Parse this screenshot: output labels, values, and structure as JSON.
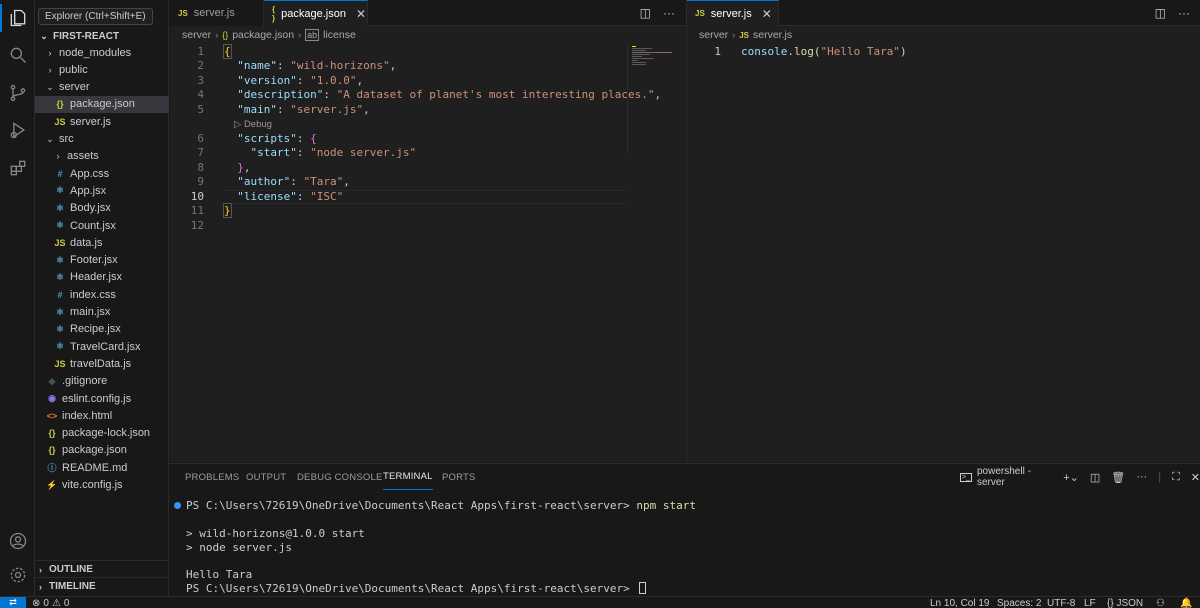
{
  "tooltip": "Explorer (Ctrl+Shift+E)",
  "sidebar": {
    "root": "FIRST-REACT",
    "outline": "OUTLINE",
    "timeline": "TIMELINE",
    "items": [
      {
        "label": "node_modules",
        "icon": "folder",
        "chev": "›"
      },
      {
        "label": "public",
        "icon": "folder",
        "chev": "›"
      },
      {
        "label": "server",
        "icon": "folder-open",
        "chev": "⌄"
      },
      {
        "label": "package.json",
        "icon": "json",
        "glyph": "{}"
      },
      {
        "label": "server.js",
        "icon": "js",
        "glyph": "JS"
      },
      {
        "label": "src",
        "icon": "folder-open",
        "chev": "⌄"
      },
      {
        "label": "assets",
        "icon": "folder",
        "chev": "›"
      },
      {
        "label": "App.css",
        "icon": "css",
        "glyph": "#"
      },
      {
        "label": "App.jsx",
        "icon": "react",
        "glyph": "⚛"
      },
      {
        "label": "Body.jsx",
        "icon": "react",
        "glyph": "⚛"
      },
      {
        "label": "Count.jsx",
        "icon": "react",
        "glyph": "⚛"
      },
      {
        "label": "data.js",
        "icon": "js",
        "glyph": "JS"
      },
      {
        "label": "Footer.jsx",
        "icon": "react",
        "glyph": "⚛"
      },
      {
        "label": "Header.jsx",
        "icon": "react",
        "glyph": "⚛"
      },
      {
        "label": "index.css",
        "icon": "css",
        "glyph": "#"
      },
      {
        "label": "main.jsx",
        "icon": "react",
        "glyph": "⚛"
      },
      {
        "label": "Recipe.jsx",
        "icon": "react",
        "glyph": "⚛"
      },
      {
        "label": "TravelCard.jsx",
        "icon": "react",
        "glyph": "⚛"
      },
      {
        "label": "travelData.js",
        "icon": "js",
        "glyph": "JS"
      },
      {
        "label": ".gitignore",
        "icon": "git",
        "glyph": "◆"
      },
      {
        "label": "eslint.config.js",
        "icon": "eslint",
        "glyph": "◉"
      },
      {
        "label": "index.html",
        "icon": "html",
        "glyph": "<>"
      },
      {
        "label": "package-lock.json",
        "icon": "json",
        "glyph": "{}"
      },
      {
        "label": "package.json",
        "icon": "json",
        "glyph": "{}"
      },
      {
        "label": "README.md",
        "icon": "info",
        "glyph": "ⓘ"
      },
      {
        "label": "vite.config.js",
        "icon": "vite",
        "glyph": "⚡"
      }
    ]
  },
  "editor_left": {
    "tabs": [
      {
        "label": "server.js",
        "glyph": "JS"
      },
      {
        "label": "package.json",
        "glyph": "{ }"
      }
    ],
    "breadcrumb": [
      "server",
      "package.json",
      "license"
    ],
    "codelens": "▷ Debug",
    "lines": [
      "1",
      "2",
      "3",
      "4",
      "5",
      "6",
      "7",
      "8",
      "9",
      "10",
      "11",
      "12"
    ],
    "code": {
      "name_key": "\"name\"",
      "name_val": "\"wild-horizons\"",
      "version_key": "\"version\"",
      "version_val": "\"1.0.0\"",
      "desc_key": "\"description\"",
      "desc_val": "\"A dataset of planet's most interesting places.\"",
      "main_key": "\"main\"",
      "main_val": "\"server.js\"",
      "scripts_key": "\"scripts\"",
      "start_key": "\"start\"",
      "start_val": "\"node server.js\"",
      "author_key": "\"author\"",
      "author_val": "\"Tara\"",
      "license_key": "\"license\"",
      "license_val": "\"ISC\""
    }
  },
  "editor_right": {
    "tab": {
      "label": "server.js",
      "glyph": "JS"
    },
    "breadcrumb": [
      "server",
      "server.js"
    ],
    "line_number": "1",
    "code_fn": "console",
    "code_method": ".log(",
    "code_str": "\"Hello Tara\"",
    "code_end": ")"
  },
  "panel": {
    "tabs": [
      "PROBLEMS",
      "OUTPUT",
      "DEBUG CONSOLE",
      "TERMINAL",
      "PORTS"
    ],
    "terminal_name": "powershell - server",
    "prompt1": "PS C:\\Users\\72619\\OneDrive\\Documents\\React Apps\\first-react\\server> ",
    "cmd1": "npm start",
    "out1": "> wild-horizons@1.0.0 start",
    "out2": "> node server.js",
    "out3": "Hello Tara",
    "prompt2": "PS C:\\Users\\72619\\OneDrive\\Documents\\React Apps\\first-react\\server> "
  },
  "status": {
    "errors": "0",
    "warnings": "0",
    "position": "Ln 10, Col 19",
    "spaces": "Spaces: 2",
    "encoding": "UTF-8",
    "eol": "LF",
    "language": "{} JSON"
  },
  "colors": {
    "accent": "#0078d4",
    "string": "#ce9178",
    "key": "#9cdcfe",
    "bracket": "#ffd700"
  }
}
